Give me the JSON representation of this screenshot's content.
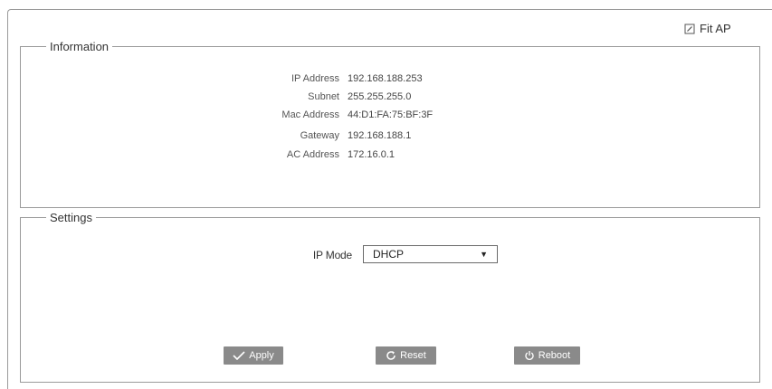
{
  "header": {
    "fit_ap_label": "Fit AP"
  },
  "information": {
    "legend": "Information",
    "rows": [
      {
        "label": "IP Address",
        "value": "192.168.188.253"
      },
      {
        "label": "Subnet",
        "value": "255.255.255.0"
      },
      {
        "label": "Mac Address",
        "value": "44:D1:FA:75:BF:3F"
      },
      {
        "label": "Gateway",
        "value": "192.168.188.1"
      },
      {
        "label": "AC Address",
        "value": "172.16.0.1"
      }
    ]
  },
  "settings": {
    "legend": "Settings",
    "ip_mode_label": "IP Mode",
    "ip_mode_value": "DHCP"
  },
  "buttons": {
    "apply": "Apply",
    "reset": "Reset",
    "reboot": "Reboot"
  },
  "icons": {
    "fit_ap": "edit-icon",
    "apply": "check-icon",
    "reset": "refresh-icon",
    "reboot": "power-icon"
  },
  "colors": {
    "button_bg": "#8a8a8a",
    "border": "#9a9a9a"
  }
}
